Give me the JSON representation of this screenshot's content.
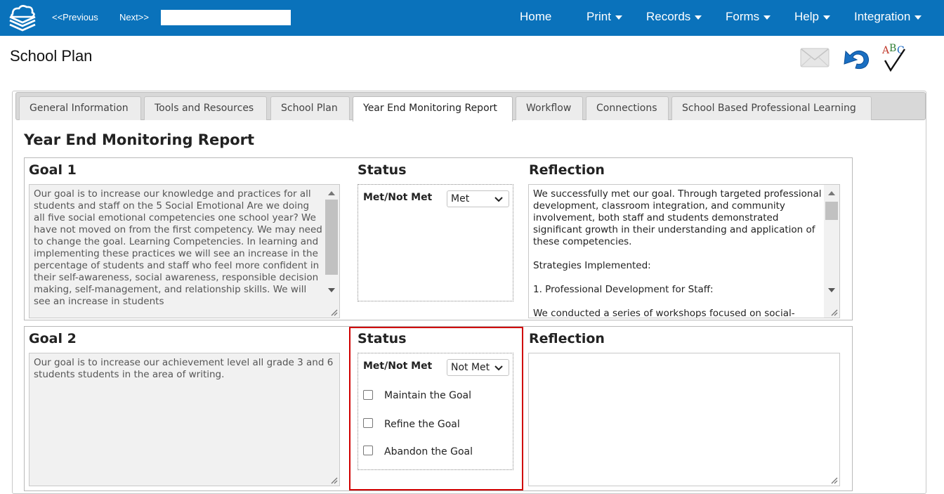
{
  "nav": {
    "previous": "<<Previous",
    "next": "Next>>",
    "search_value": "",
    "menu": [
      "Home",
      "Print",
      "Records",
      "Forms",
      "Help",
      "Integration"
    ]
  },
  "page": {
    "title": "School Plan"
  },
  "icons": {
    "email": "envelope-icon",
    "undo": "undo-arrow-icon",
    "spellcheck": "abc-spellcheck-icon"
  },
  "tabs": [
    {
      "label": "General Information"
    },
    {
      "label": "Tools and Resources"
    },
    {
      "label": "School Plan"
    },
    {
      "label": "Year End Monitoring Report",
      "active": true
    },
    {
      "label": "Workflow"
    },
    {
      "label": "Connections"
    },
    {
      "label": "School Based Professional Learning"
    }
  ],
  "report": {
    "title": "Year End Monitoring Report",
    "status_heading": "Status",
    "reflection_heading": "Reflection",
    "met_label": "Met/Not Met",
    "goals": [
      {
        "title": "Goal 1",
        "text": "Our goal is to increase our knowledge and practices for all students and staff on the 5 Social Emotional Are we doing all five social emotional competencies one school year? We have not moved on from the first competency. We may need to change the goal. Learning Competencies.  In learning and implementing these practices we will see an increase in the percentage of students and staff who feel more confident in their self-awareness, social awareness, responsible decision making, self-management, and relationship skills.  We will see an increase in students",
        "status": "Met",
        "reflection_lines": [
          "We successfully met our goal. Through targeted professional development, classroom integration, and community involvement, both staff and students demonstrated significant growth in their understanding and application of these competencies.",
          "Strategies Implemented:",
          "1.  Professional Development for Staff:",
          "We conducted a series of workshops focused on social-"
        ]
      },
      {
        "title": "Goal 2",
        "text": "Our goal is to increase our achievement level all grade 3 and 6 students students in the area of writing.",
        "status": "Not Met",
        "reflection": "",
        "options": [
          "Maintain the Goal",
          "Refine the Goal",
          "Abandon the Goal"
        ]
      }
    ]
  },
  "colors": {
    "topbar": "#0a72bb",
    "highlight": "#d00000"
  }
}
